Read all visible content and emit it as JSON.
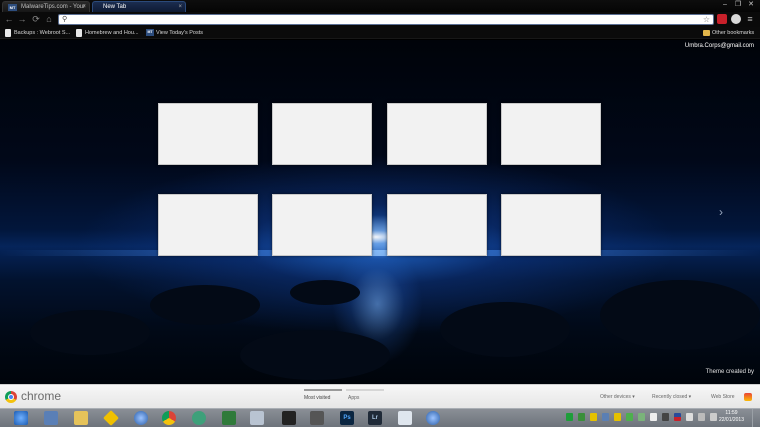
{
  "tabs": [
    {
      "favicon": "MT",
      "label": "MalwareTips.com - Your"
    },
    {
      "label": "New Tab"
    }
  ],
  "toolbar": {
    "omnibox_value": "",
    "omnibox_placeholder": ""
  },
  "bookmarks": [
    {
      "label": "Backups : Webroot S...",
      "icon": "doc-icon"
    },
    {
      "label": "Homebrew and Hou...",
      "icon": "doc-icon"
    },
    {
      "label": "View Today's Posts",
      "icon": "mt-icon",
      "favicon": "MT"
    }
  ],
  "other_bookmarks": "Other bookmarks",
  "account": "Umbra.Corps@gmail.com",
  "theme_credit": "Theme created by",
  "footer": {
    "brand": "chrome",
    "tabs": [
      "Most visited",
      "Apps"
    ],
    "other_devices": "Other devices ▾",
    "recently_closed": "Recently closed ▾",
    "web_store": "Web Store"
  },
  "taskbar": {
    "time": "11:59",
    "date": "22/01/2013",
    "apps": [
      "Ps",
      "Lr"
    ]
  },
  "colors": {
    "tab_active": "#1b2d4f",
    "footer_active_bar": "#9a9a9a",
    "footer_inactive_bar": "#d6d6d6"
  }
}
